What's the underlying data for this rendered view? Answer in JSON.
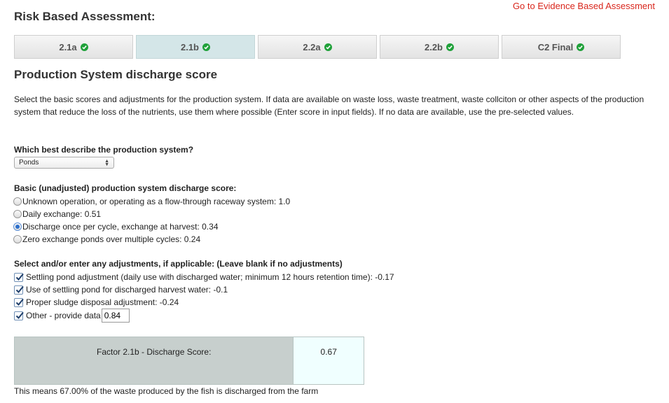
{
  "header": {
    "title": "Risk Based Assessment:",
    "evidence_link": "Go to Evidence Based Assessment"
  },
  "tabs": [
    {
      "label": "2.1a",
      "complete": true,
      "active": false
    },
    {
      "label": "2.1b",
      "complete": true,
      "active": true
    },
    {
      "label": "2.2a",
      "complete": true,
      "active": false
    },
    {
      "label": "2.2b",
      "complete": true,
      "active": false
    },
    {
      "label": "C2 Final",
      "complete": true,
      "active": false
    }
  ],
  "section": {
    "title": "Production System discharge score",
    "intro": "Select the basic scores and adjustments for the production system. If data are available on waste loss, waste treatment, waste collciton or other aspects of the production system that reduce the loss of the nutrients, use them where possible (Enter score in input fields). If no data are available, use the pre-selected values."
  },
  "system_question": {
    "label": "Which best describe the production system?",
    "selected": "Ponds"
  },
  "basic_score": {
    "label": "Basic (unadjusted) production system discharge score:",
    "options": [
      {
        "label": "Unknown operation, or operating as a flow-through raceway system: 1.0",
        "checked": false
      },
      {
        "label": "Daily exchange: 0.51",
        "checked": false
      },
      {
        "label": "Discharge once per cycle, exchange at harvest: 0.34",
        "checked": true
      },
      {
        "label": "Zero exchange ponds over multiple cycles: 0.24",
        "checked": false
      }
    ]
  },
  "adjustments": {
    "label": "Select and/or enter any adjustments, if applicable: (Leave blank if no adjustments)",
    "items": [
      {
        "label": "Settling pond adjustment (daily use with discharged water; minimum 12 hours retention time): -0.17",
        "checked": true
      },
      {
        "label": "Use of settling pond for discharged harvest water: -0.1",
        "checked": true
      },
      {
        "label": "Proper sludge disposal adjustment: -0.24",
        "checked": true
      }
    ],
    "other": {
      "label": "Other - provide data",
      "checked": true,
      "value": "0.84"
    }
  },
  "result": {
    "label": "Factor 2.1b - Discharge Score:",
    "value": "0.67",
    "summary": "This means 67.00% of the waste produced by the fish is discharged from the farm"
  },
  "colors": {
    "link": "#d9261c",
    "check_green": "#20a13a",
    "active_tab": "#d4e6e8",
    "result_label_bg": "#c7cfcd",
    "result_value_bg": "#f0ffff"
  }
}
